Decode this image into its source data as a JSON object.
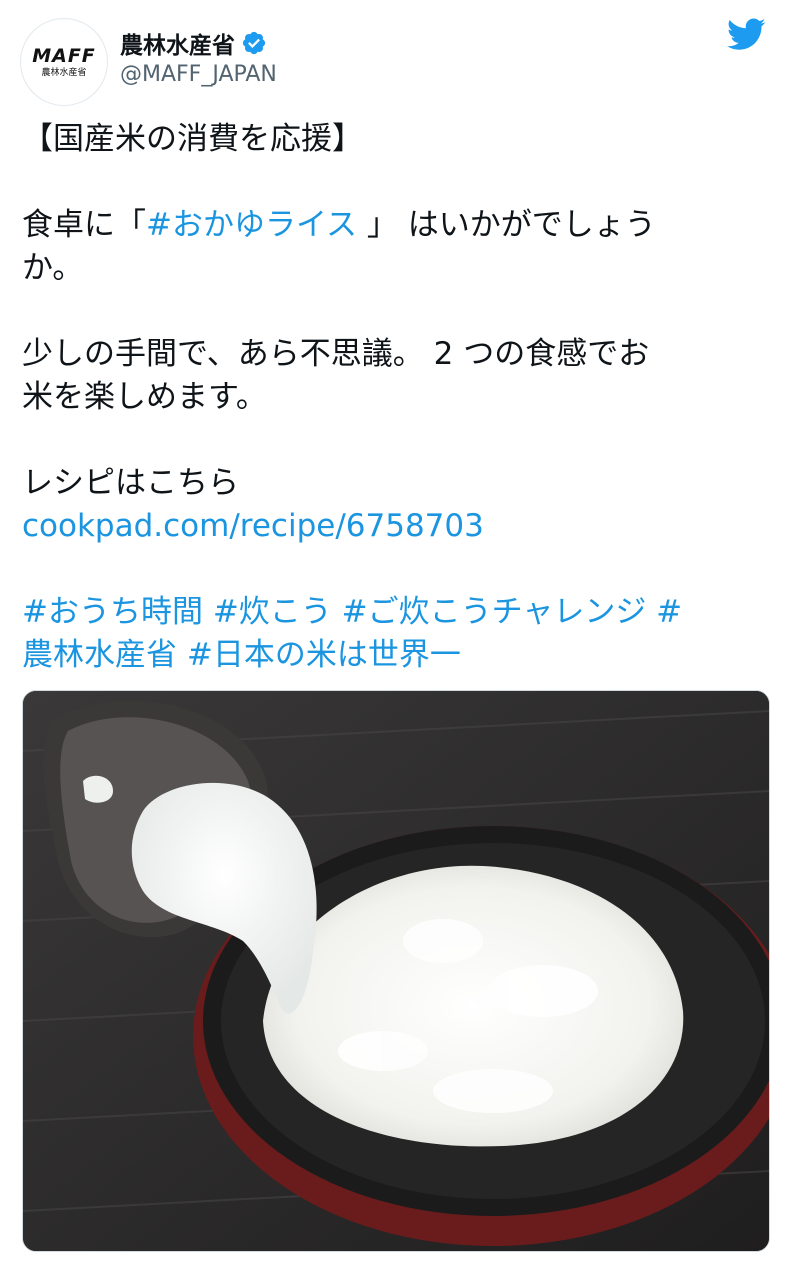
{
  "author": {
    "display_name": "農林水産省",
    "handle": "@MAFF_JAPAN",
    "avatar_logo": "MAFF",
    "avatar_logo_sub": "農林水産省",
    "verified": true
  },
  "tweet": {
    "line1": "【国産米の消費を応援】",
    "line2_prefix": "食卓に「",
    "line2_hashtag": "#おかゆライス",
    "line2_suffix": "」 はいかがでしょう",
    "line2_wrap": "か。",
    "line3a": "少しの手間で、あら不思議。 2 つの食感でお",
    "line3b": "米を楽しめます。",
    "line4": "レシピはこちら",
    "link": "cookpad.com/recipe/6758703",
    "hashtags_line1": "#おうち時間  #炊こう #ご炊こうチャレンジ #",
    "hashtags_line2": "農林水産省 #日本の米は世界一"
  },
  "icons": {
    "verified": "verified-badge-icon",
    "brand": "twitter-bird-icon"
  },
  "colors": {
    "link": "#1b95e0",
    "text": "#0f1419",
    "handle": "#536471"
  }
}
